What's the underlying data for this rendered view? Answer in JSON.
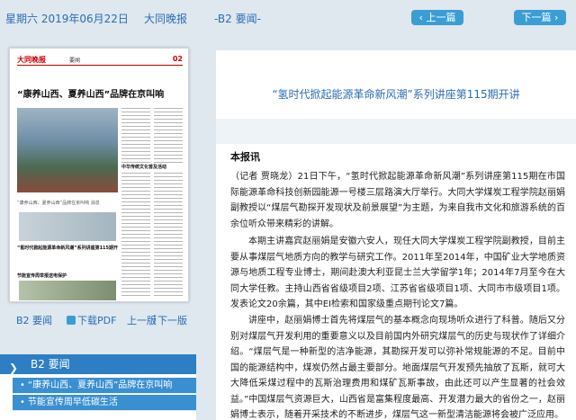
{
  "header": {
    "date": "星期六 2019年06月22日",
    "paper_name": "大同晚报",
    "page_label": "-B2 要闻-",
    "prev_button": "上一篇",
    "next_button": "下一篇"
  },
  "page_thumb": {
    "logo": "大同晚报",
    "section": "要闻",
    "page_num": "02",
    "headline": "“康养山西、夏养山西”品牌在京叫响",
    "photo_caption": "“康养山西、夏养山西”品牌在京叫响 消息",
    "subhead_1": "“氢时代掀起能源革命新风潮”系列讲座第115期开讲",
    "subhead_2": "节能宣传周举报送电保护",
    "col_head": "中华传统文化普及活动"
  },
  "thumb_links": {
    "page": "B2 要闻",
    "pdf": "下载PDF",
    "prev_page": "上一版",
    "separator": "|",
    "next_page": "下一版"
  },
  "sidebar": {
    "section": "B2  要闻",
    "items": [
      "“康养山西、夏养山西”品牌在京叫响",
      "节能宣传周早低碳生活"
    ]
  },
  "article": {
    "title": "“氢时代掀起能源革命新风潮”系列讲座第115期开讲",
    "byline": "本报讯",
    "paragraphs": [
      "（记者 贾晓龙）21日下午，“氢时代掀起能源革命新风潮”系列讲座第115期在市国际能源革命科技创新园能源一号楼三层路演大厅举行。大同大学煤炭工程学院赵丽娟副教授以“煤层气勘探开发现状及前景展望”为主题，为来自我市文化和旅游系统的百余位听众带来精彩的讲解。",
      "本期主讲嘉宾赵丽娟是安徽六安人，现任大同大学煤炭工程学院副教授，目前主要从事煤层气地质方向的教学与研究工作。2011年至2014年，中国矿业大学地质资源与地质工程专业博士，期间赴澳大利亚昆士兰大学留学1年；2014年7月至今在大同大学任教。主持山西省省级项目2项、江苏省省级项目1项、大同市市级项目1项。发表论文20余篇，其中EI检索和国家级重点期刊论文7篇。",
      "讲座中，赵丽娟博士首先将煤层气的基本概念向现场听众进行了科普。随后又分别对煤层气开发利用的重要意义以及目前国内外研究煤层气的历史与现状作了详细介绍。“煤层气是一种新型的洁净能源，其勘探开发可以弥补常规能源的不足。目前中国的能源结构中，煤炭仍然占最主要部分。地面煤层气开发预先抽放了瓦斯，就可大大降低采煤过程中的瓦斯治理费用和煤矿瓦斯事故，由此还可以产生显著的社会效益。”中国煤层气资源巨大，山西省是富集程度最高、开发潜力最大的省份之一，赵丽娟博士表示，随着开采技术的不断进步，煤层气这一新型清洁能源将会被广泛应用。"
    ]
  }
}
